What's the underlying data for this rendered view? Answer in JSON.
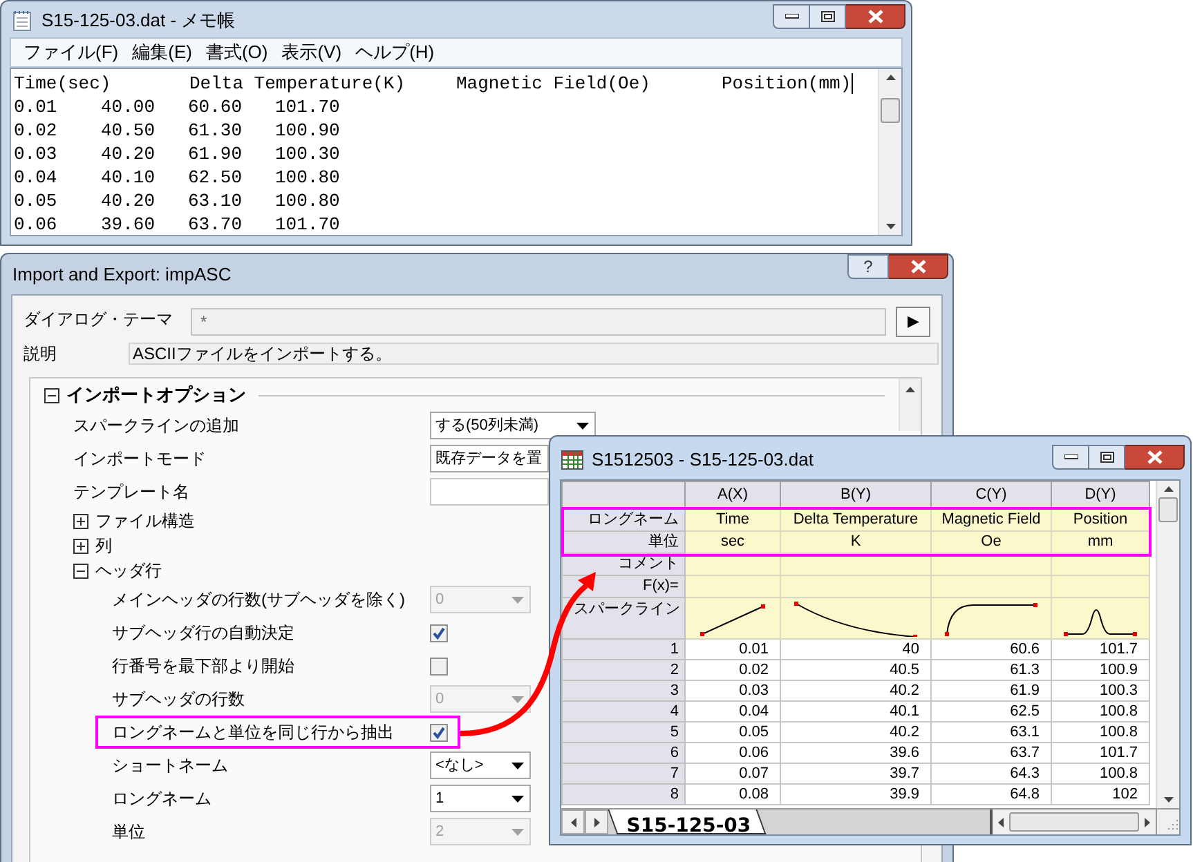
{
  "notepad": {
    "title": "S15-125-03.dat - メモ帳",
    "menu": [
      "ファイル(F)",
      "編集(E)",
      "書式(O)",
      "表示(V)",
      "ヘルプ(H)"
    ],
    "header": [
      "Time(sec)",
      "Delta Temperature(K)",
      "Magnetic Field(Oe)",
      "Position(mm)"
    ],
    "rows": [
      [
        "0.01",
        "40.00",
        "60.60",
        "101.70"
      ],
      [
        "0.02",
        "40.50",
        "61.30",
        "100.90"
      ],
      [
        "0.03",
        "40.20",
        "61.90",
        "100.30"
      ],
      [
        "0.04",
        "40.10",
        "62.50",
        "100.80"
      ],
      [
        "0.05",
        "40.20",
        "63.10",
        "100.80"
      ],
      [
        "0.06",
        "39.60",
        "63.70",
        "101.70"
      ]
    ]
  },
  "dialog": {
    "title": "Import and Export: impASC",
    "help": "?",
    "theme": {
      "label": "ダイアログ・テーマ",
      "value": "*",
      "button": "▶"
    },
    "description": {
      "label": "説明",
      "value": "ASCIIファイルをインポートする。"
    },
    "group": {
      "title": "インポートオプション",
      "expanded": true,
      "items": [
        {
          "kind": "dropdown",
          "label": "スパークラインの追加",
          "value": "する(50列未満)",
          "disabled": false
        },
        {
          "kind": "dropdown",
          "label": "インポートモード",
          "value": "既存データを置",
          "disabled": false
        },
        {
          "kind": "text",
          "label": "テンプレート名"
        },
        {
          "kind": "node",
          "label": "ファイル構造",
          "expanded": false
        },
        {
          "kind": "node",
          "label": "列",
          "expanded": false
        },
        {
          "kind": "node",
          "label": "ヘッダ行",
          "expanded": true,
          "children": [
            {
              "kind": "dropdown",
              "label": "メインヘッダの行数(サブヘッダを除く)",
              "value": "0",
              "disabled": true
            },
            {
              "kind": "checkbox",
              "label": "サブヘッダ行の自動決定",
              "checked": true,
              "highlighted": false
            },
            {
              "kind": "checkbox",
              "label": "行番号を最下部より開始",
              "checked": false,
              "highlighted": false
            },
            {
              "kind": "dropdown",
              "label": "サブヘッダの行数",
              "value": "0",
              "disabled": true
            },
            {
              "kind": "checkbox",
              "label": "ロングネームと単位を同じ行から抽出",
              "checked": true,
              "highlighted": true
            },
            {
              "kind": "dropdown",
              "label": "ショートネーム",
              "value": "<なし>",
              "disabled": false
            },
            {
              "kind": "dropdown",
              "label": "ロングネーム",
              "value": "1",
              "disabled": false
            },
            {
              "kind": "dropdown",
              "label": "単位",
              "value": "2",
              "disabled": true
            }
          ]
        }
      ]
    }
  },
  "worksheet": {
    "title": "S1512503 - S15-125-03.dat",
    "columns": [
      {
        "name": "A(X)",
        "kind": "rising"
      },
      {
        "name": "B(Y)",
        "kind": "falling"
      },
      {
        "name": "C(Y)",
        "kind": "saturating"
      },
      {
        "name": "D(Y)",
        "kind": "peak"
      }
    ],
    "label_rows": [
      {
        "label": "ロングネーム",
        "cells": [
          "Time",
          "Delta Temperature",
          "Magnetic Field",
          "Position"
        ],
        "highlighted": true
      },
      {
        "label": "単位",
        "cells": [
          "sec",
          "K",
          "Oe",
          "mm"
        ],
        "highlighted": true
      },
      {
        "label": "コメント",
        "cells": [],
        "highlighted": false
      },
      {
        "label": "F(x)=",
        "cells": [],
        "highlighted": false
      }
    ],
    "sparkline_label": "スパークライン",
    "rows": [
      {
        "index": "1",
        "cells": [
          "0.01",
          "40",
          "60.6",
          "101.7"
        ]
      },
      {
        "index": "2",
        "cells": [
          "0.02",
          "40.5",
          "61.3",
          "100.9"
        ]
      },
      {
        "index": "3",
        "cells": [
          "0.03",
          "40.2",
          "61.9",
          "100.3"
        ]
      },
      {
        "index": "4",
        "cells": [
          "0.04",
          "40.1",
          "62.5",
          "100.8"
        ]
      },
      {
        "index": "5",
        "cells": [
          "0.05",
          "40.2",
          "63.1",
          "100.8"
        ]
      },
      {
        "index": "6",
        "cells": [
          "0.06",
          "39.6",
          "63.7",
          "101.7"
        ]
      },
      {
        "index": "7",
        "cells": [
          "0.07",
          "39.7",
          "64.3",
          "100.8"
        ]
      },
      {
        "index": "8",
        "cells": [
          "0.08",
          "39.9",
          "64.8",
          "102"
        ]
      }
    ],
    "sheets": [
      {
        "label": "S15-125-03",
        "selected": true
      }
    ]
  }
}
